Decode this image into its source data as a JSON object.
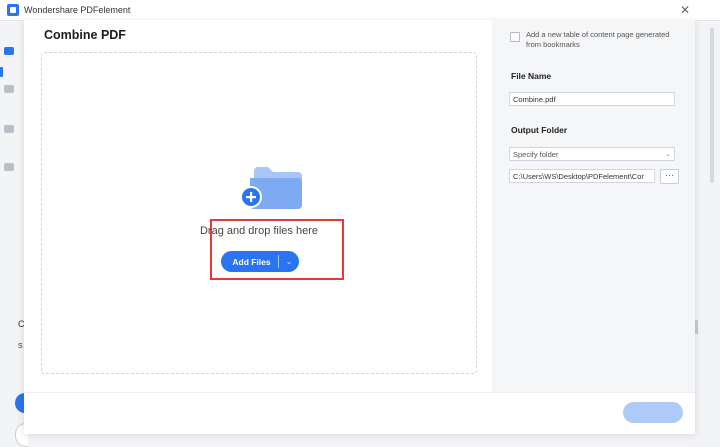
{
  "app": {
    "title": "Wondershare PDFelement",
    "close_glyph": "✕"
  },
  "rail": {
    "frag_top": "C",
    "frag_bottom": "S"
  },
  "dialog": {
    "title": "Combine PDF",
    "drop_zone": {
      "icon": "folder-plus-icon",
      "text": "Drag and drop files here",
      "add_button_label": "Add Files",
      "add_button_dropdown_icon": "chevron-down-icon"
    },
    "settings": {
      "toc_checkbox": {
        "checked": false,
        "label": "Add a new table of content page generated from bookmarks"
      },
      "file_name_label": "File Name",
      "file_name_value": "Combine.pdf",
      "output_folder_label": "Output Folder",
      "output_folder_option": "Specify folder",
      "output_path": "C:\\Users\\WS\\Desktop\\PDFelement\\Cor",
      "browse_label": "···"
    },
    "footer": {
      "combine_button_label": ""
    }
  },
  "colors": {
    "accent": "#2b74f0",
    "disabled_accent": "#aecbf8",
    "highlight": "#e53935"
  }
}
